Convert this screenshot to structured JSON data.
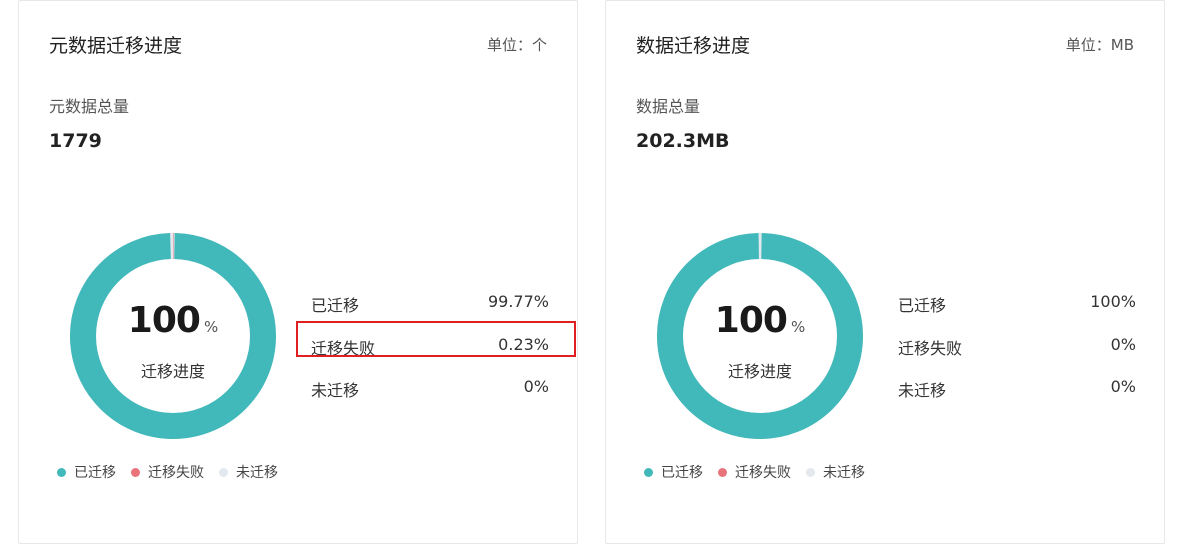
{
  "colors": {
    "migrated": "#41b8ba",
    "failed": "#e8737a",
    "not_migrated": "#e3e8ef",
    "highlight": "#e02020"
  },
  "cards": [
    {
      "title": "元数据迁移进度",
      "unit": "单位：个",
      "total_label": "元数据总量",
      "total_value": "1779",
      "progress_value": "100",
      "progress_unit": "%",
      "progress_label": "迁移进度",
      "donut": {
        "migrated": 99.77,
        "failed": 0.23,
        "not_migrated": 0
      },
      "stats": [
        {
          "label": "已迁移",
          "value": "99.77%"
        },
        {
          "label": "迁移失败",
          "value": "0.23%"
        },
        {
          "label": "未迁移",
          "value": "0%"
        }
      ],
      "legend": [
        "已迁移",
        "迁移失败",
        "未迁移"
      ]
    },
    {
      "title": "数据迁移进度",
      "unit": "单位：MB",
      "total_label": "数据总量",
      "total_value": "202.3MB",
      "progress_value": "100",
      "progress_unit": "%",
      "progress_label": "迁移进度",
      "donut": {
        "migrated": 100,
        "failed": 0,
        "not_migrated": 0
      },
      "stats": [
        {
          "label": "已迁移",
          "value": "100%"
        },
        {
          "label": "迁移失败",
          "value": "0%"
        },
        {
          "label": "未迁移",
          "value": "0%"
        }
      ],
      "legend": [
        "已迁移",
        "迁移失败",
        "未迁移"
      ]
    }
  ]
}
